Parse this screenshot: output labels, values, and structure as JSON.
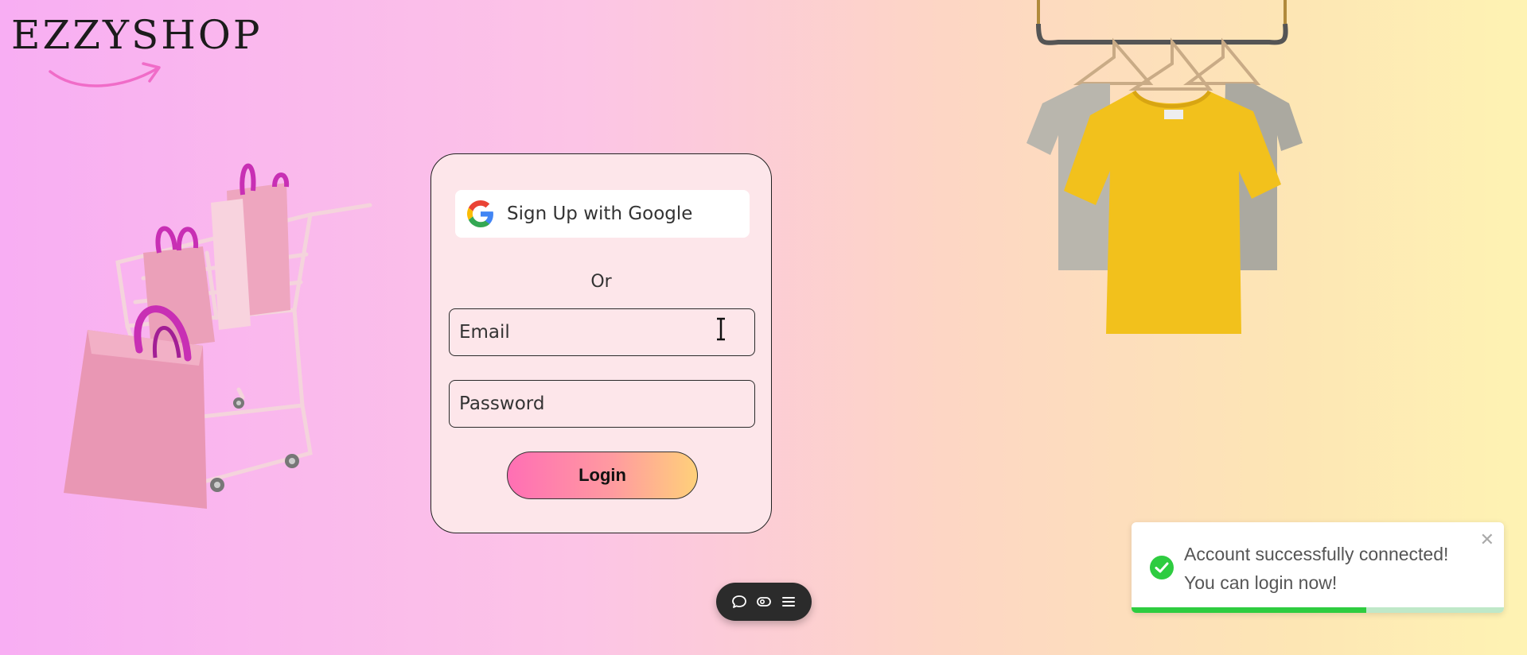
{
  "brand": {
    "logo_text": "EZZYSHOP"
  },
  "auth": {
    "google_label": "Sign Up with Google",
    "or_label": "Or",
    "email_placeholder": "Email",
    "password_placeholder": "Password",
    "login_label": "Login"
  },
  "toolbar": {
    "icons": [
      "comment-icon",
      "eye-icon",
      "menu-icon"
    ]
  },
  "toast": {
    "line1": "Account successfully connected!",
    "line2": "You can login now!",
    "close": "✕",
    "progress": 0.63
  },
  "colors": {
    "google_blue": "#4285F4",
    "google_red": "#EA4335",
    "google_yellow": "#FBBC05",
    "google_green": "#34A853",
    "success": "#2ecc40"
  }
}
